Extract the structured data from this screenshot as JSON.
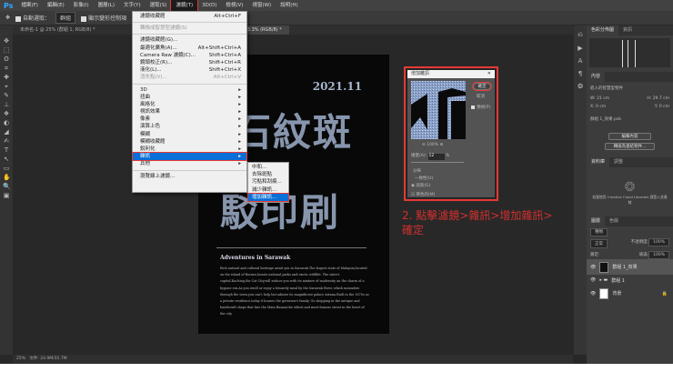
{
  "app": {
    "logo": "Ps"
  },
  "menubar": [
    "檔案(F)",
    "編輯(E)",
    "影像(I)",
    "圖層(L)",
    "文字(Y)",
    "選取(S)",
    "濾鏡(T)",
    "3D(D)",
    "檢視(V)",
    "視窗(W)",
    "說明(H)"
  ],
  "options": {
    "auto_select": "自動選取：",
    "auto_select_value": "群組",
    "transform": "顯示變形控制項"
  },
  "tabs": [
    "未命名-1 @ 25% (群組 1, RGB/8) *",
    "未命名-2 @ 33.3% (RGB/8) *"
  ],
  "filter_menu": {
    "items": [
      {
        "label": "濾鏡收藏館",
        "shortcut": "Alt+Ctrl+F"
      },
      {
        "sep": true
      },
      {
        "label": "轉換成智慧型濾鏡(S)",
        "disabled": true
      },
      {
        "sep": true
      },
      {
        "label": "濾鏡收藏館(G)..."
      },
      {
        "label": "最適化廣角(A)...",
        "shortcut": "Alt+Shift+Ctrl+A"
      },
      {
        "label": "Camera Raw 濾鏡(C)...",
        "shortcut": "Shift+Ctrl+A"
      },
      {
        "label": "鏡頭校正(R)...",
        "shortcut": "Shift+Ctrl+R"
      },
      {
        "label": "液化(L)...",
        "shortcut": "Shift+Ctrl+X"
      },
      {
        "label": "消失點(V)...",
        "shortcut": "Alt+Ctrl+V",
        "disabled": true
      },
      {
        "sep": true
      },
      {
        "label": "3D",
        "sub": true
      },
      {
        "label": "扭曲",
        "sub": true
      },
      {
        "label": "風格化",
        "sub": true
      },
      {
        "label": "視訊效果",
        "sub": true
      },
      {
        "label": "像素",
        "sub": true
      },
      {
        "label": "演算上色",
        "sub": true
      },
      {
        "label": "模糊",
        "sub": true
      },
      {
        "label": "模糊收藏館",
        "sub": true
      },
      {
        "label": "銳利化",
        "sub": true
      },
      {
        "label": "雜訊",
        "sub": true,
        "highlight": true
      },
      {
        "label": "其他",
        "sub": true
      },
      {
        "sep": true
      },
      {
        "label": "瀏覽線上濾鏡..."
      }
    ]
  },
  "noise_submenu": [
    "中和...",
    "去除斑點",
    "污點和刮痕...",
    "減少雜訊...",
    "增加雜訊..."
  ],
  "dialog": {
    "title": "增加雜訊",
    "ok": "確定",
    "cancel": "取消",
    "preview": "預視(P)",
    "zoom": "100%",
    "amount_label": "總量(A):",
    "amount": "12",
    "unit": "%",
    "distribution": "分佈",
    "uniform": "一致性(U)",
    "gaussian": "高斯(G)",
    "mono": "單色的(M)"
  },
  "annotation": "2. 點擊濾鏡>雜訊>增加雜訊>確定",
  "document": {
    "date": "2021.11",
    "line1": "石紋斑",
    "line2": "駁印刷",
    "article_title": "Adventures in Sarawak",
    "article_body": "Rich natural and cultural heritage await you in Sarawak.The largest state of Malaysia,located on the island of Borneo,boasts national parks and exotic wildlife. The state's capital,Kuching,the Cat City,will seduce you with its mixture of modernity an the charm of a bygone era.As you stroll or enjoy a leisurely meal by the Sarawak River, which meanders through the town,you can't help but admire its magnificent palace Astana.Built in the 1870s as a private residence,today it houses the governor's family. Go shopping in the antique and handicraft shops that line the Main Bazaar,the oldest and most famous street in the heart of the city."
  },
  "panels": {
    "top_tabs": [
      "色彩分佈圖",
      "資訊"
    ],
    "props_tab": "內容",
    "smart": "嵌入的智慧型物件",
    "w": "W: 21 cm",
    "h": "H: 29.7 cm",
    "x": "X: 0 cm",
    "y": "Y: 0 cm",
    "file": "群組 1_效果.psb",
    "edit_btn": "編輯內容",
    "convert_btn": "轉換為連結物件...",
    "lib_tabs": [
      "資料庫",
      "調整"
    ],
    "cc_text": "若要使用 Creative Cloud Libraries 請登入並連線",
    "layer_tabs": [
      "圖層",
      "色版"
    ],
    "kind": "種類",
    "blend": "正常",
    "opacity_label": "不透明度:",
    "opacity": "100%",
    "lock": "鎖定:",
    "fill_label": "填滿:",
    "fill": "100%",
    "layers": [
      "群組 1_效果",
      "群組 1",
      "背景"
    ]
  },
  "status": {
    "zoom": "25%",
    "doc": "文件: 24.9M/35.7M"
  }
}
